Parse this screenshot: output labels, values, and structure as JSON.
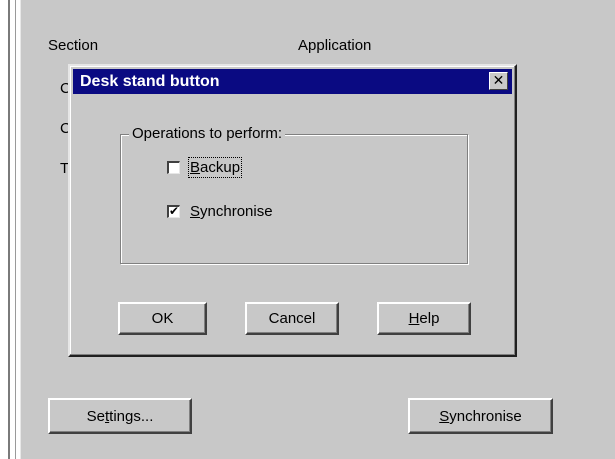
{
  "background": {
    "col_section": "Section",
    "col_application": "Application",
    "row_initials": [
      "C",
      "C",
      "T"
    ],
    "settings_label_pre": "Se",
    "settings_label_ul": "t",
    "settings_label_post": "tings...",
    "sync_label_ul": "S",
    "sync_label_post": "ynchronise"
  },
  "dialog": {
    "title": "Desk stand button",
    "close_glyph": "✕",
    "group_label": "Operations to perform:",
    "options": [
      {
        "ul": "B",
        "rest": "ackup",
        "checked": false,
        "check_glyph": ""
      },
      {
        "ul": "S",
        "rest": "ynchronise",
        "checked": true,
        "check_glyph": "✔"
      }
    ],
    "ok_label": "OK",
    "cancel_label": "Cancel",
    "help_label_ul": "H",
    "help_label_post": "elp"
  },
  "colors": {
    "titlebar": "#0a0a82",
    "face": "#c8c8c8"
  }
}
